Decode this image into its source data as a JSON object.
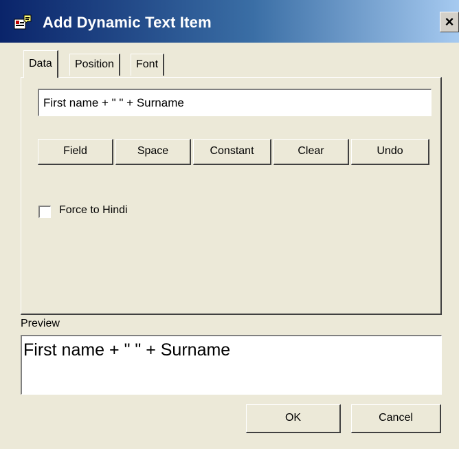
{
  "window": {
    "title": "Add Dynamic Text Item",
    "close_label": "×",
    "title_gradient": [
      "#0a246a",
      "#3a6ea5",
      "#a6caf0"
    ]
  },
  "tabs": [
    {
      "label": "Data",
      "active": true
    },
    {
      "label": "Position",
      "active": false
    },
    {
      "label": "Font",
      "active": false
    }
  ],
  "data_tab": {
    "expression_value": "First name + \" \" + Surname",
    "buttons": {
      "field": "Field",
      "space": "Space",
      "constant": "Constant",
      "clear": "Clear",
      "undo": "Undo"
    },
    "force_hindi": {
      "label": "Force to Hindi",
      "checked": false
    }
  },
  "preview": {
    "label": "Preview",
    "text": "First name + \" \" + Surname"
  },
  "footer": {
    "ok_label": "OK",
    "cancel_label": "Cancel"
  }
}
